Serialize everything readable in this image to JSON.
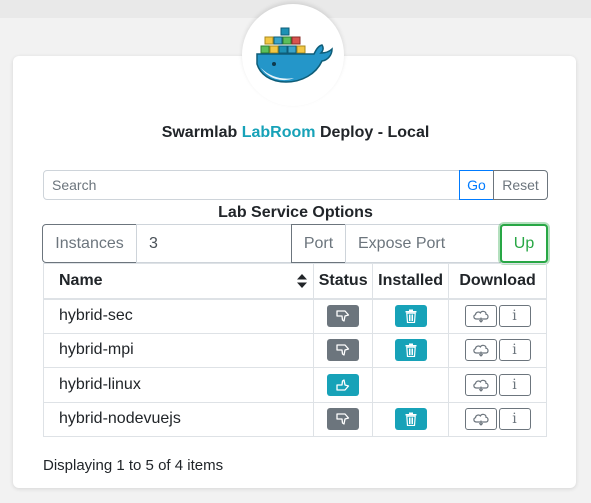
{
  "app": {
    "title_prefix": "Swarmlab ",
    "title_accent": "LabRoom",
    "title_suffix": " Deploy - Local",
    "accent_color": "#17a2b8",
    "logo_icon": "docker-whale-icon"
  },
  "search": {
    "placeholder": "Search",
    "value": "",
    "go_label": "Go",
    "reset_label": "Reset"
  },
  "options": {
    "heading": "Lab Service Options",
    "instances_label": "Instances",
    "instances_value": "3",
    "port_label": "Port",
    "port_placeholder": "Expose Port",
    "up_label": "Up"
  },
  "table": {
    "headers": {
      "name": "Name",
      "status": "Status",
      "installed": "Installed",
      "download": "Download"
    },
    "rows": [
      {
        "name": "hybrid-sec",
        "status": "down",
        "installed": true
      },
      {
        "name": "hybrid-mpi",
        "status": "down",
        "installed": true
      },
      {
        "name": "hybrid-linux",
        "status": "up",
        "installed": false
      },
      {
        "name": "hybrid-nodevuejs",
        "status": "down",
        "installed": true
      }
    ]
  },
  "footer": {
    "text": "Displaying 1 to 5 of 4 items"
  },
  "icons": {
    "status_down": "thumbs-down-icon",
    "status_up": "thumbs-up-icon",
    "installed": "trash-icon",
    "download": "cloud-icon",
    "info": "info-icon",
    "sort": "sort-icon"
  }
}
